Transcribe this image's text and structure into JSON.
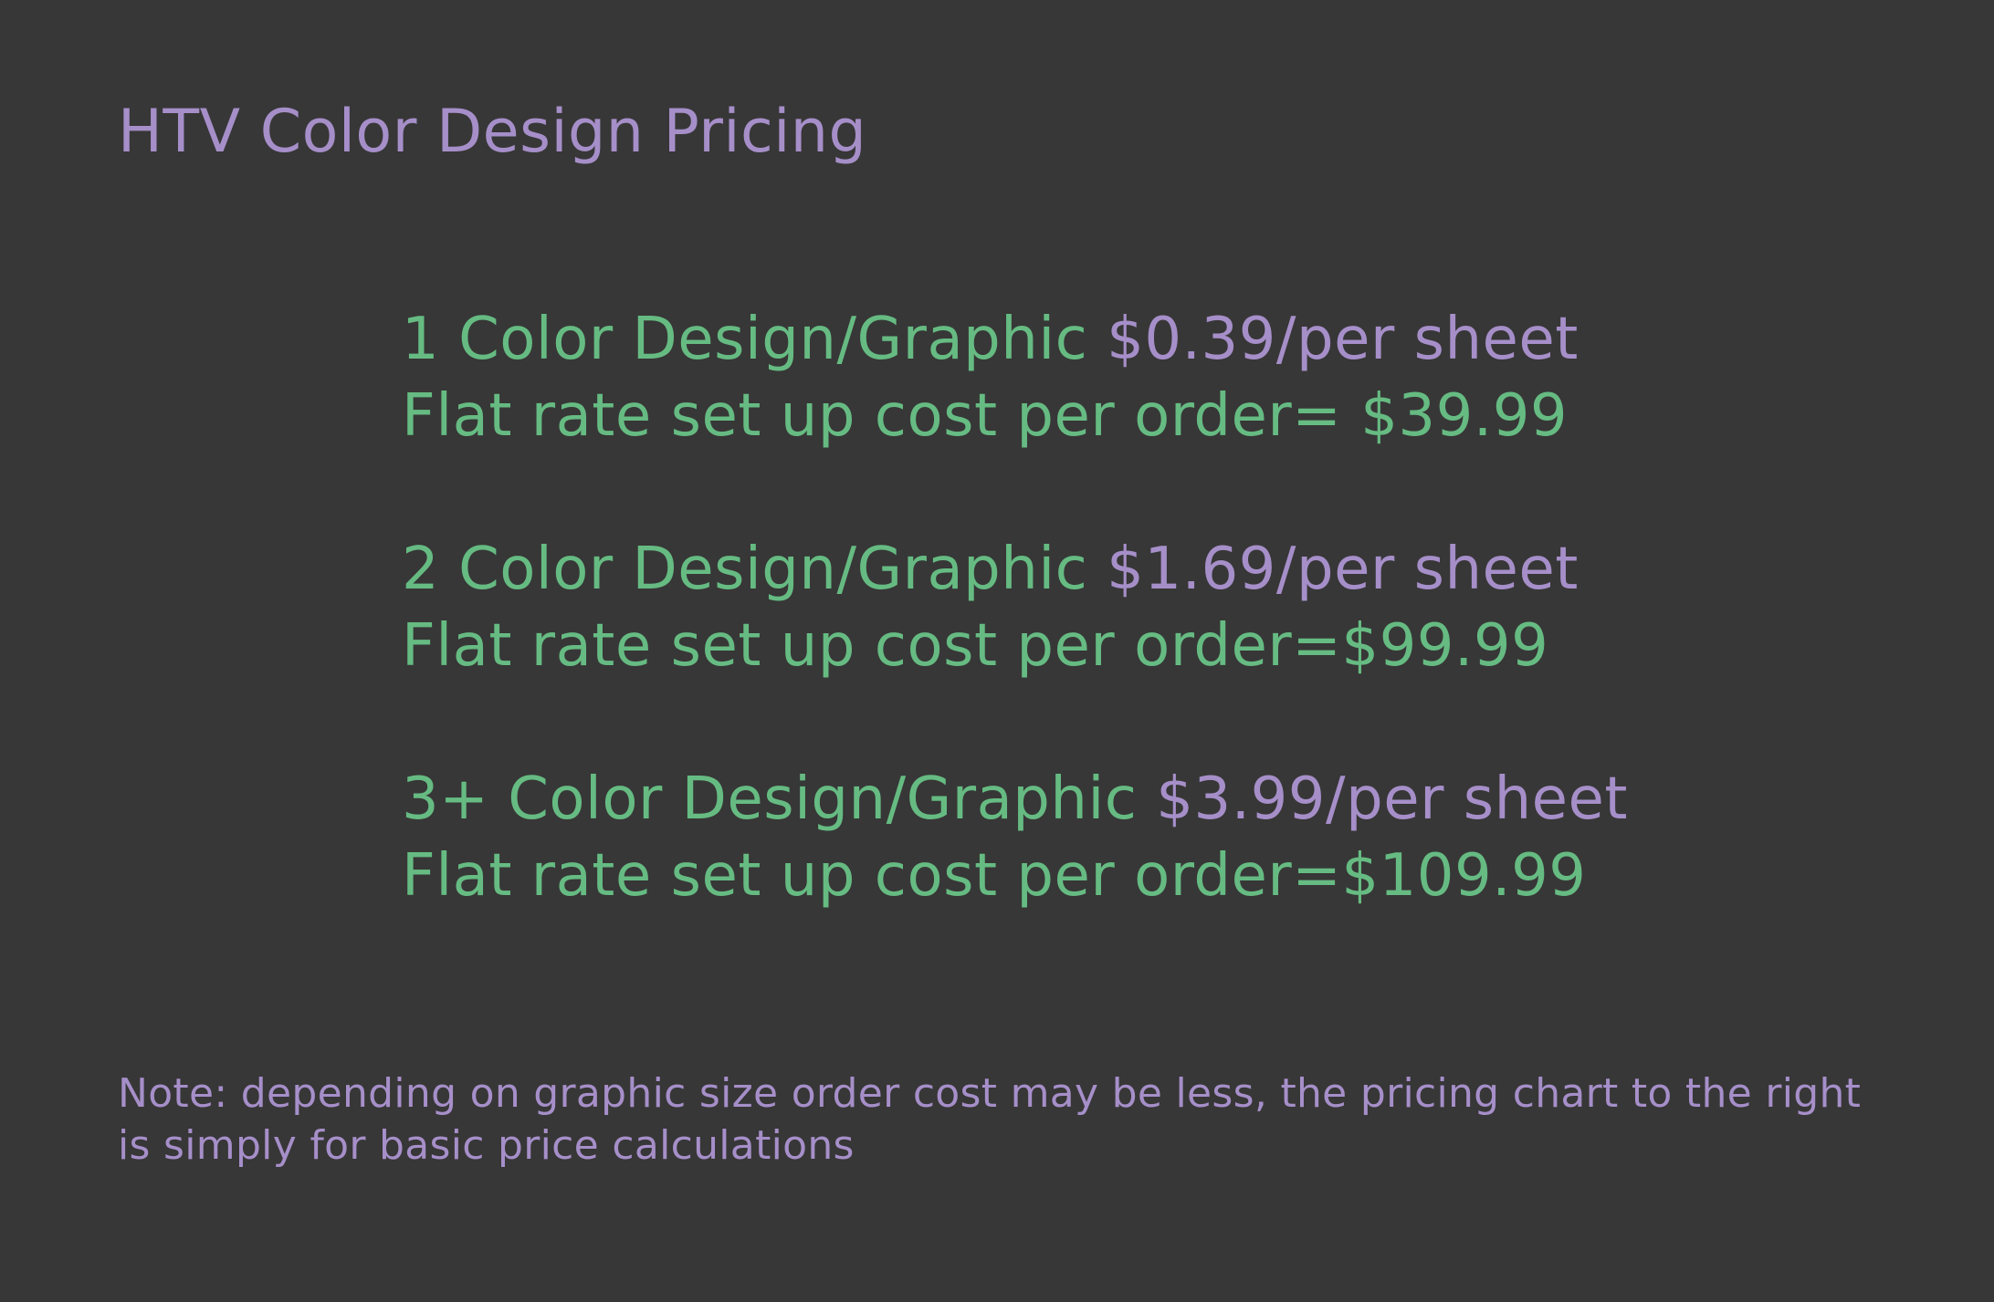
{
  "title": "HTV Color Design Pricing",
  "tiers": [
    {
      "label": "1 Color Design/Graphic ",
      "per_sheet_price": "$0.39/per sheet",
      "setup_label": "Flat rate set up cost per order= $39.99"
    },
    {
      "label": "2 Color Design/Graphic ",
      "per_sheet_price": "$1.69/per sheet",
      "setup_label": "Flat rate set up cost per order=$99.99"
    },
    {
      "label": "3+ Color Design/Graphic ",
      "per_sheet_price": "$3.99/per sheet",
      "setup_label": "Flat rate set up cost per order=$109.99"
    }
  ],
  "note": "Note: depending on graphic size order cost may be less, the pricing chart to the right is simply for basic price calculations",
  "colors": {
    "background": "#373737",
    "purple": "#a68fc9",
    "green": "#66bb82"
  }
}
